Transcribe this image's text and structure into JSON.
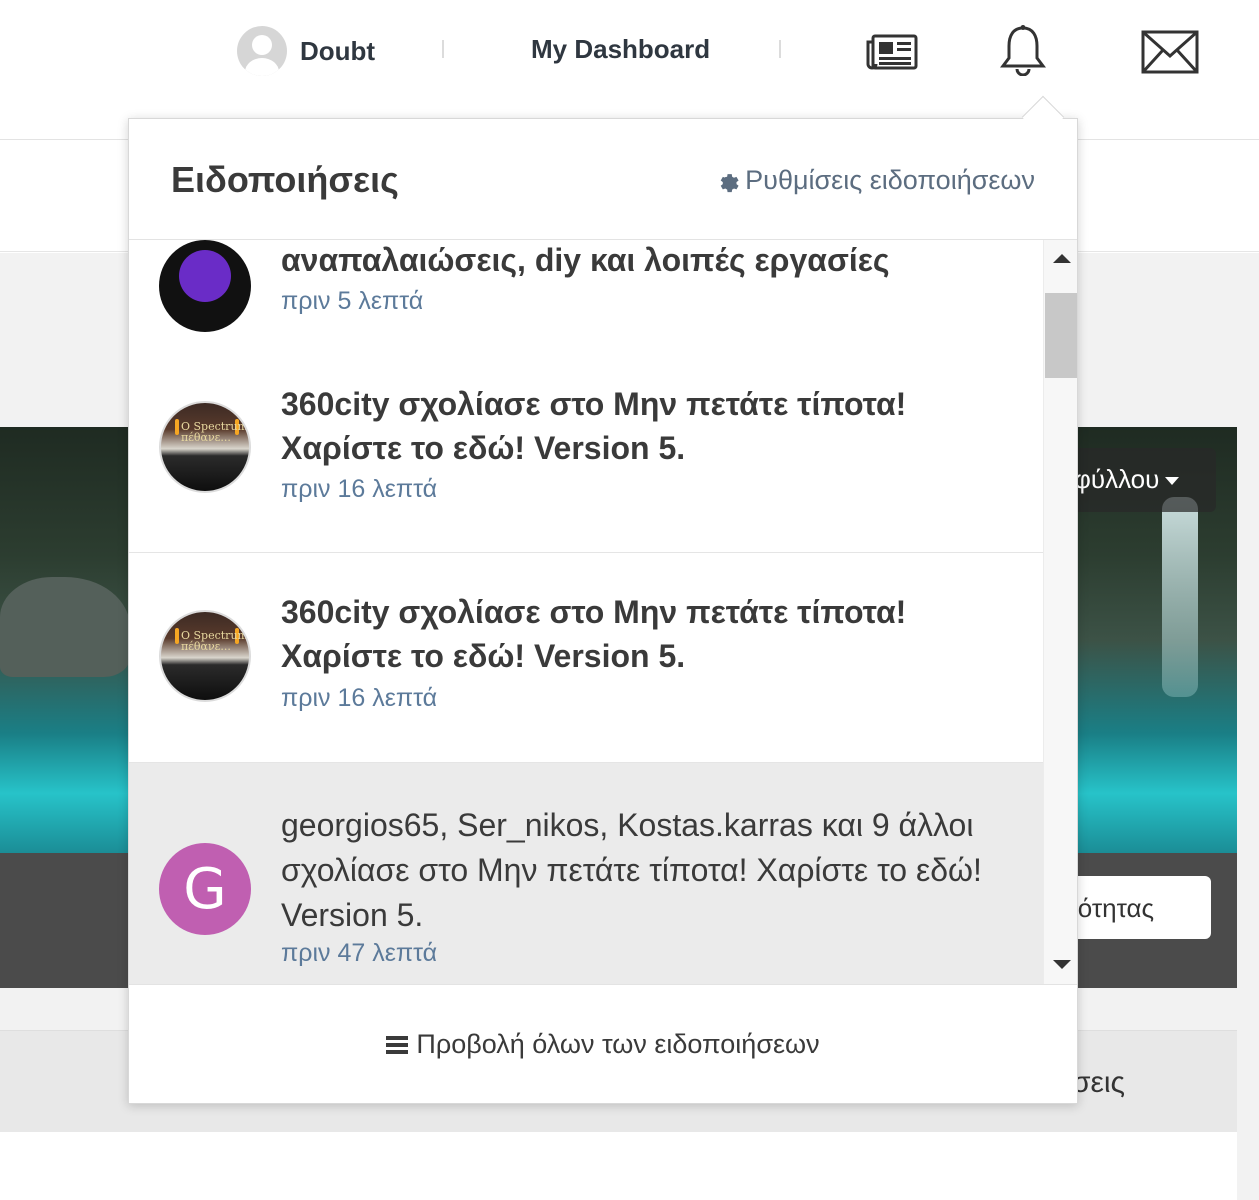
{
  "nav": {
    "user_name": "Doubt",
    "dashboard_label": "My Dashboard",
    "icons": [
      "newspaper-icon",
      "bell-icon",
      "envelope-icon"
    ]
  },
  "background": {
    "cover_button_partial": "φύλλου",
    "cover_button2_partial": "ιότητας",
    "section_title_partial": "σεις"
  },
  "dropdown": {
    "title": "Ειδοποιήσεις",
    "settings_label": "Ρυθμίσεις ειδοποιήσεων",
    "footer_label": "Προβολή όλων των ειδοποιήσεων",
    "items": [
      {
        "text": "αναπαλαιώσεις, diy και λοιπές εργασίες",
        "time": "πριν 5 λεπτά",
        "avatar": "purple",
        "unread": false
      },
      {
        "text": "360city σχολίασε στο Μην πετάτε τίποτα! Χαρίστε το εδώ! Version 5.",
        "time": "πριν 16 λεπτά",
        "avatar": "spectrum",
        "unread": false
      },
      {
        "text": "360city σχολίασε στο Μην πετάτε τίποτα! Χαρίστε το εδώ! Version 5.",
        "time": "πριν 16 λεπτά",
        "avatar": "spectrum",
        "unread": false
      },
      {
        "text": "georgios65, Ser_nikos, Kostas.karras και 9 άλλοι σχολίασε στο Μην πετάτε τίποτα! Χαρίστε το εδώ! Version 5.",
        "time": "πριν 47 λεπτά",
        "avatar": "G",
        "unread": true
      }
    ],
    "avatar_spectrum_text": "O Spectrum πέθανε...",
    "avatar_letter": "G"
  },
  "colors": {
    "link": "#5c7a9a",
    "unread_bg": "#ebebeb",
    "avatar_g": "#c05fb1"
  }
}
